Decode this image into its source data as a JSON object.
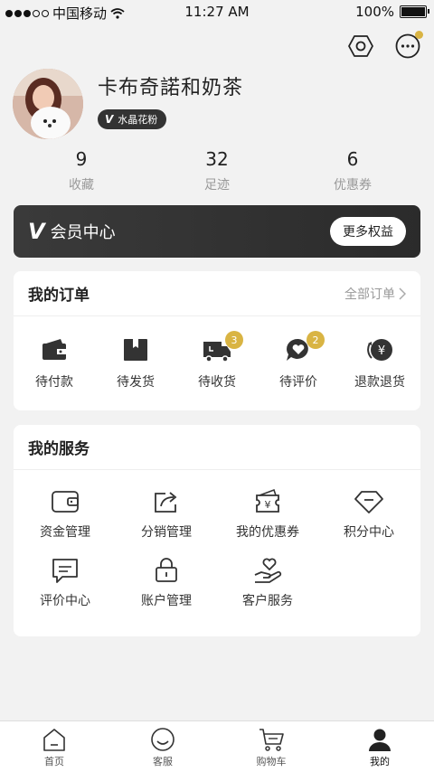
{
  "status_bar": {
    "carrier": "中国移动",
    "time": "11:27 AM",
    "battery": "100%",
    "battery_level": 1.0
  },
  "profile": {
    "username": "卡布奇諾和奶茶",
    "badge": "水晶花粉",
    "badge_mark": "V"
  },
  "stats": [
    {
      "value": "9",
      "label": "收藏"
    },
    {
      "value": "32",
      "label": "足迹"
    },
    {
      "value": "6",
      "label": "优惠券"
    }
  ],
  "member": {
    "mark": "V",
    "title": "会员中心",
    "button": "更多权益"
  },
  "orders": {
    "title": "我的订单",
    "link": "全部订单",
    "items": [
      {
        "label": "待付款",
        "icon": "wallet-icon",
        "count": ""
      },
      {
        "label": "待发货",
        "icon": "box-icon",
        "count": ""
      },
      {
        "label": "待收货",
        "icon": "truck-icon",
        "count": "3"
      },
      {
        "label": "待评价",
        "icon": "heart-chat-icon",
        "count": "2"
      },
      {
        "label": "退款退货",
        "icon": "refund-icon",
        "count": ""
      }
    ]
  },
  "services": {
    "title": "我的服务",
    "items": [
      {
        "label": "资金管理",
        "icon": "wallet-outline-icon"
      },
      {
        "label": "分销管理",
        "icon": "share-icon"
      },
      {
        "label": "我的优惠券",
        "icon": "coupon-icon"
      },
      {
        "label": "积分中心",
        "icon": "diamond-icon"
      },
      {
        "label": "评价中心",
        "icon": "comment-icon"
      },
      {
        "label": "账户管理",
        "icon": "lock-icon"
      },
      {
        "label": "客户服务",
        "icon": "hand-heart-icon"
      }
    ]
  },
  "tabbar": {
    "items": [
      {
        "label": "首页",
        "icon": "home-icon",
        "active": false
      },
      {
        "label": "客服",
        "icon": "smile-icon",
        "active": false
      },
      {
        "label": "购物车",
        "icon": "cart-icon",
        "active": false
      },
      {
        "label": "我的",
        "icon": "user-icon",
        "active": true
      }
    ]
  },
  "colors": {
    "accent": "#d9b443",
    "dark_banner": "#333333",
    "background": "#f2f2f2"
  }
}
